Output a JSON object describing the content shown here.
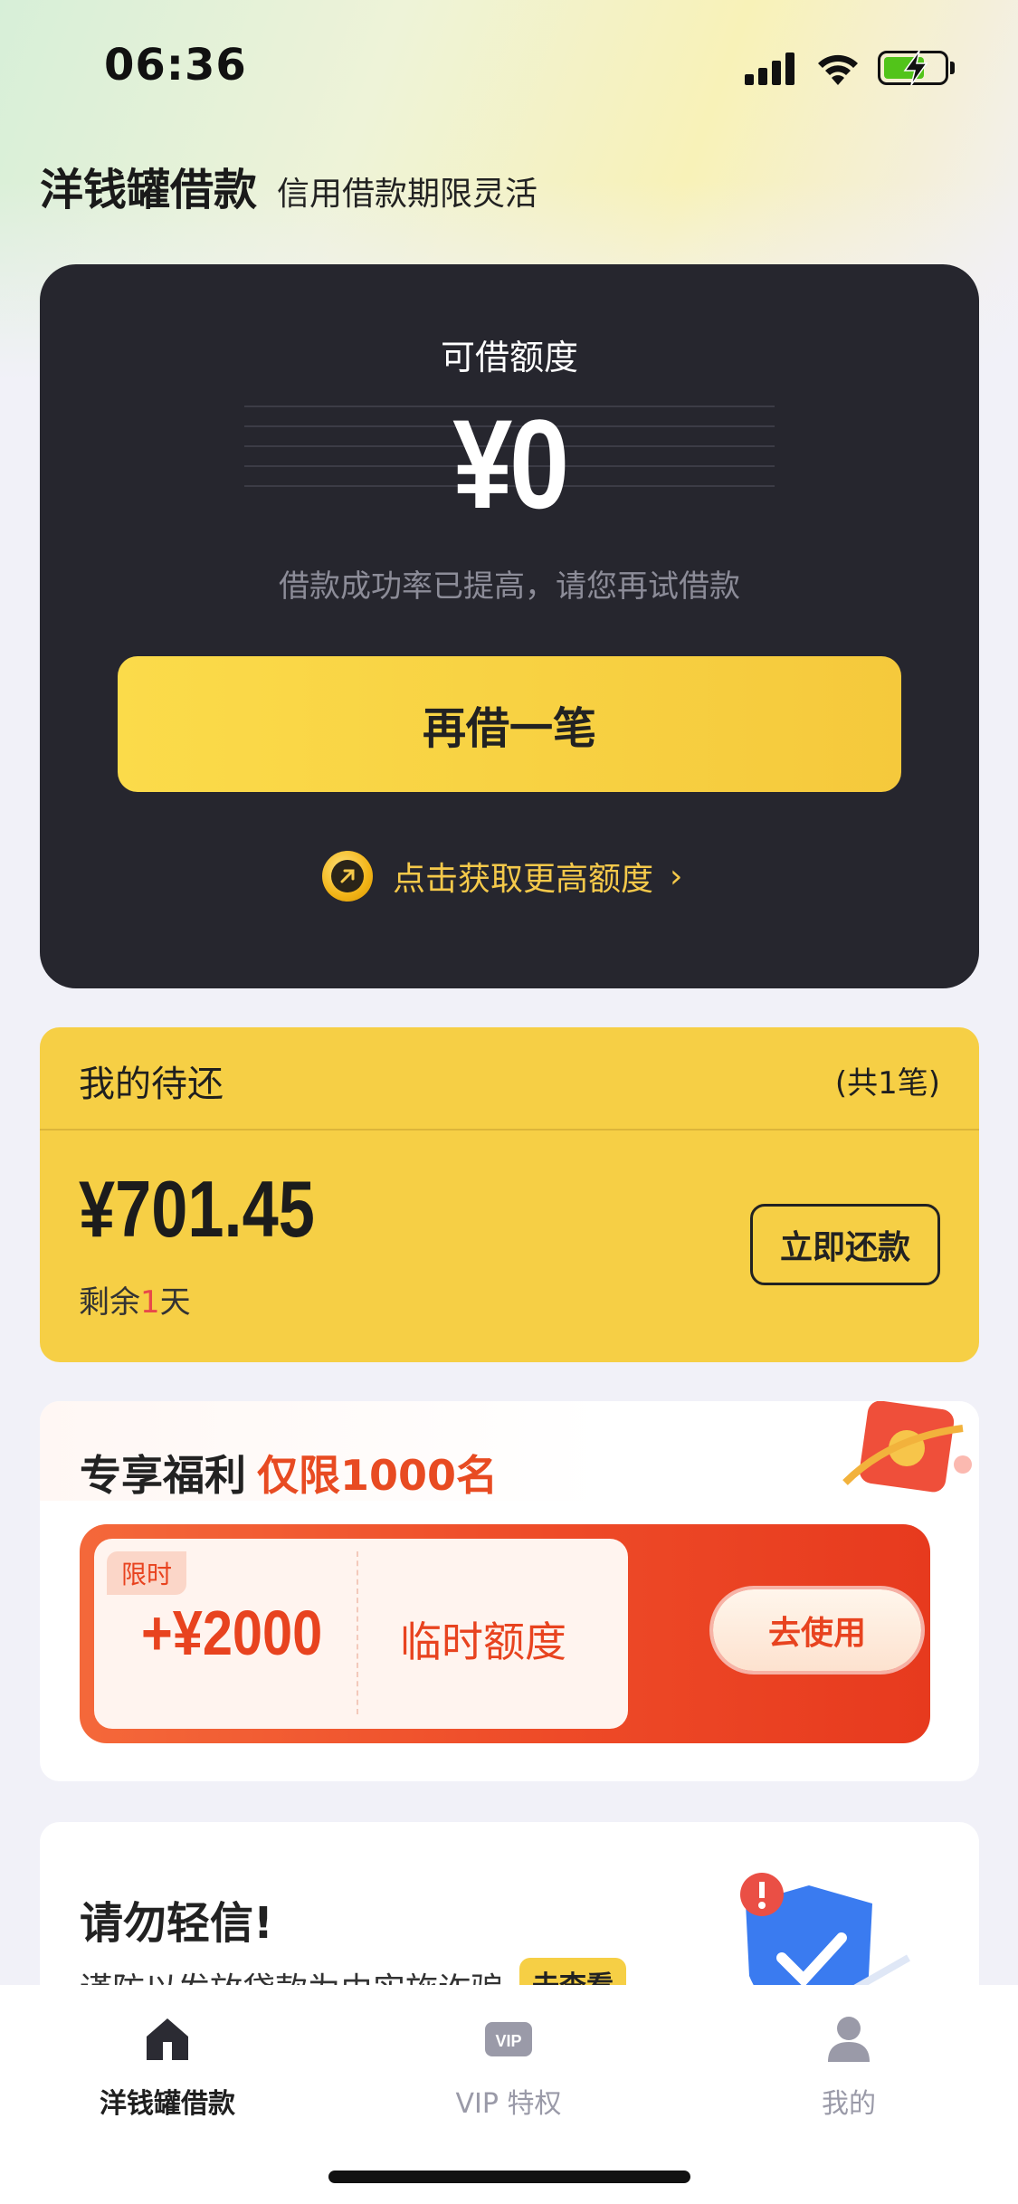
{
  "status_bar": {
    "time": "06:36"
  },
  "header": {
    "title": "洋钱罐借款",
    "subtitle": "信用借款期限灵活"
  },
  "credit_card": {
    "label": "可借额度",
    "amount": "¥0",
    "hint": "借款成功率已提高，请您再试借款",
    "borrow_button": "再借一笔",
    "raise_limit_link": "点击获取更高额度",
    "chevron": "›"
  },
  "repayment": {
    "title": "我的待还",
    "count": "(共1笔)",
    "amount": "¥701.45",
    "days_prefix": "剩余",
    "days_number": "1",
    "days_suffix": "天",
    "repay_button": "立即还款"
  },
  "benefit": {
    "title": "专享福利",
    "limit": "仅限1000名",
    "coupon_tag": "限时",
    "coupon_amount": "+¥2000",
    "coupon_desc": "临时额度",
    "use_button": "去使用"
  },
  "warning": {
    "title": "请勿轻信!",
    "text": "谨防以发放贷款为由实施诈骗",
    "link": "去查看"
  },
  "tabs": [
    {
      "label": "洋钱罐借款",
      "icon": "home-icon",
      "active": true
    },
    {
      "label": "VIP 特权",
      "icon": "vip-icon",
      "active": false
    },
    {
      "label": "我的",
      "icon": "profile-icon",
      "active": false
    }
  ],
  "colors": {
    "accent_yellow": "#f6cf45",
    "dark_card": "#26262e",
    "promo_red": "#e8431f"
  }
}
